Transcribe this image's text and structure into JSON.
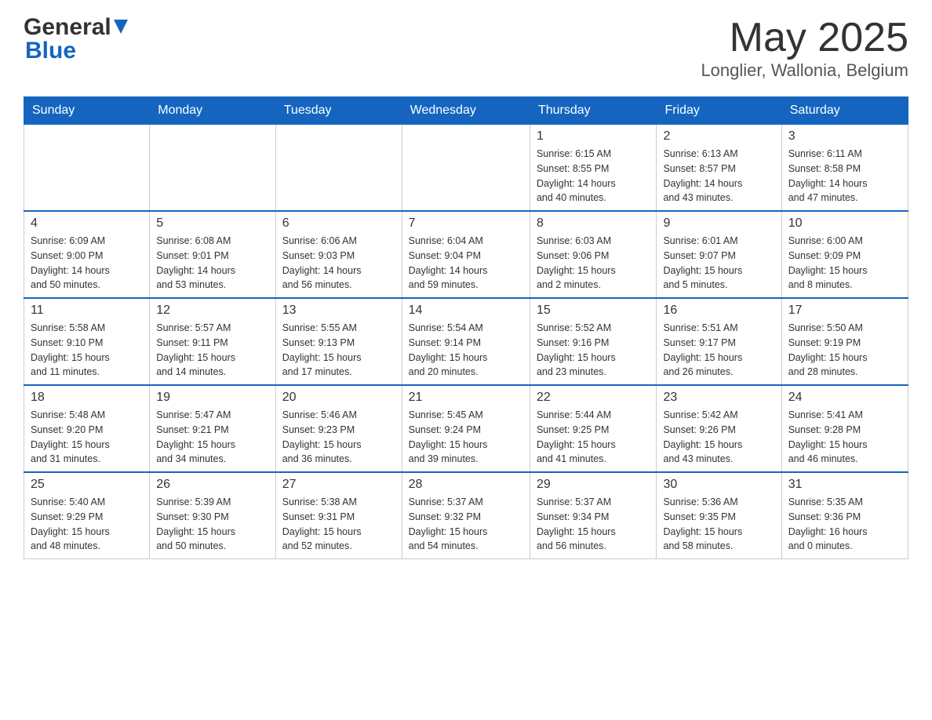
{
  "header": {
    "logo_general": "General",
    "logo_blue": "Blue",
    "month_year": "May 2025",
    "location": "Longlier, Wallonia, Belgium"
  },
  "days_of_week": [
    "Sunday",
    "Monday",
    "Tuesday",
    "Wednesday",
    "Thursday",
    "Friday",
    "Saturday"
  ],
  "weeks": [
    [
      {
        "day": "",
        "info": ""
      },
      {
        "day": "",
        "info": ""
      },
      {
        "day": "",
        "info": ""
      },
      {
        "day": "",
        "info": ""
      },
      {
        "day": "1",
        "info": "Sunrise: 6:15 AM\nSunset: 8:55 PM\nDaylight: 14 hours\nand 40 minutes."
      },
      {
        "day": "2",
        "info": "Sunrise: 6:13 AM\nSunset: 8:57 PM\nDaylight: 14 hours\nand 43 minutes."
      },
      {
        "day": "3",
        "info": "Sunrise: 6:11 AM\nSunset: 8:58 PM\nDaylight: 14 hours\nand 47 minutes."
      }
    ],
    [
      {
        "day": "4",
        "info": "Sunrise: 6:09 AM\nSunset: 9:00 PM\nDaylight: 14 hours\nand 50 minutes."
      },
      {
        "day": "5",
        "info": "Sunrise: 6:08 AM\nSunset: 9:01 PM\nDaylight: 14 hours\nand 53 minutes."
      },
      {
        "day": "6",
        "info": "Sunrise: 6:06 AM\nSunset: 9:03 PM\nDaylight: 14 hours\nand 56 minutes."
      },
      {
        "day": "7",
        "info": "Sunrise: 6:04 AM\nSunset: 9:04 PM\nDaylight: 14 hours\nand 59 minutes."
      },
      {
        "day": "8",
        "info": "Sunrise: 6:03 AM\nSunset: 9:06 PM\nDaylight: 15 hours\nand 2 minutes."
      },
      {
        "day": "9",
        "info": "Sunrise: 6:01 AM\nSunset: 9:07 PM\nDaylight: 15 hours\nand 5 minutes."
      },
      {
        "day": "10",
        "info": "Sunrise: 6:00 AM\nSunset: 9:09 PM\nDaylight: 15 hours\nand 8 minutes."
      }
    ],
    [
      {
        "day": "11",
        "info": "Sunrise: 5:58 AM\nSunset: 9:10 PM\nDaylight: 15 hours\nand 11 minutes."
      },
      {
        "day": "12",
        "info": "Sunrise: 5:57 AM\nSunset: 9:11 PM\nDaylight: 15 hours\nand 14 minutes."
      },
      {
        "day": "13",
        "info": "Sunrise: 5:55 AM\nSunset: 9:13 PM\nDaylight: 15 hours\nand 17 minutes."
      },
      {
        "day": "14",
        "info": "Sunrise: 5:54 AM\nSunset: 9:14 PM\nDaylight: 15 hours\nand 20 minutes."
      },
      {
        "day": "15",
        "info": "Sunrise: 5:52 AM\nSunset: 9:16 PM\nDaylight: 15 hours\nand 23 minutes."
      },
      {
        "day": "16",
        "info": "Sunrise: 5:51 AM\nSunset: 9:17 PM\nDaylight: 15 hours\nand 26 minutes."
      },
      {
        "day": "17",
        "info": "Sunrise: 5:50 AM\nSunset: 9:19 PM\nDaylight: 15 hours\nand 28 minutes."
      }
    ],
    [
      {
        "day": "18",
        "info": "Sunrise: 5:48 AM\nSunset: 9:20 PM\nDaylight: 15 hours\nand 31 minutes."
      },
      {
        "day": "19",
        "info": "Sunrise: 5:47 AM\nSunset: 9:21 PM\nDaylight: 15 hours\nand 34 minutes."
      },
      {
        "day": "20",
        "info": "Sunrise: 5:46 AM\nSunset: 9:23 PM\nDaylight: 15 hours\nand 36 minutes."
      },
      {
        "day": "21",
        "info": "Sunrise: 5:45 AM\nSunset: 9:24 PM\nDaylight: 15 hours\nand 39 minutes."
      },
      {
        "day": "22",
        "info": "Sunrise: 5:44 AM\nSunset: 9:25 PM\nDaylight: 15 hours\nand 41 minutes."
      },
      {
        "day": "23",
        "info": "Sunrise: 5:42 AM\nSunset: 9:26 PM\nDaylight: 15 hours\nand 43 minutes."
      },
      {
        "day": "24",
        "info": "Sunrise: 5:41 AM\nSunset: 9:28 PM\nDaylight: 15 hours\nand 46 minutes."
      }
    ],
    [
      {
        "day": "25",
        "info": "Sunrise: 5:40 AM\nSunset: 9:29 PM\nDaylight: 15 hours\nand 48 minutes."
      },
      {
        "day": "26",
        "info": "Sunrise: 5:39 AM\nSunset: 9:30 PM\nDaylight: 15 hours\nand 50 minutes."
      },
      {
        "day": "27",
        "info": "Sunrise: 5:38 AM\nSunset: 9:31 PM\nDaylight: 15 hours\nand 52 minutes."
      },
      {
        "day": "28",
        "info": "Sunrise: 5:37 AM\nSunset: 9:32 PM\nDaylight: 15 hours\nand 54 minutes."
      },
      {
        "day": "29",
        "info": "Sunrise: 5:37 AM\nSunset: 9:34 PM\nDaylight: 15 hours\nand 56 minutes."
      },
      {
        "day": "30",
        "info": "Sunrise: 5:36 AM\nSunset: 9:35 PM\nDaylight: 15 hours\nand 58 minutes."
      },
      {
        "day": "31",
        "info": "Sunrise: 5:35 AM\nSunset: 9:36 PM\nDaylight: 16 hours\nand 0 minutes."
      }
    ]
  ]
}
